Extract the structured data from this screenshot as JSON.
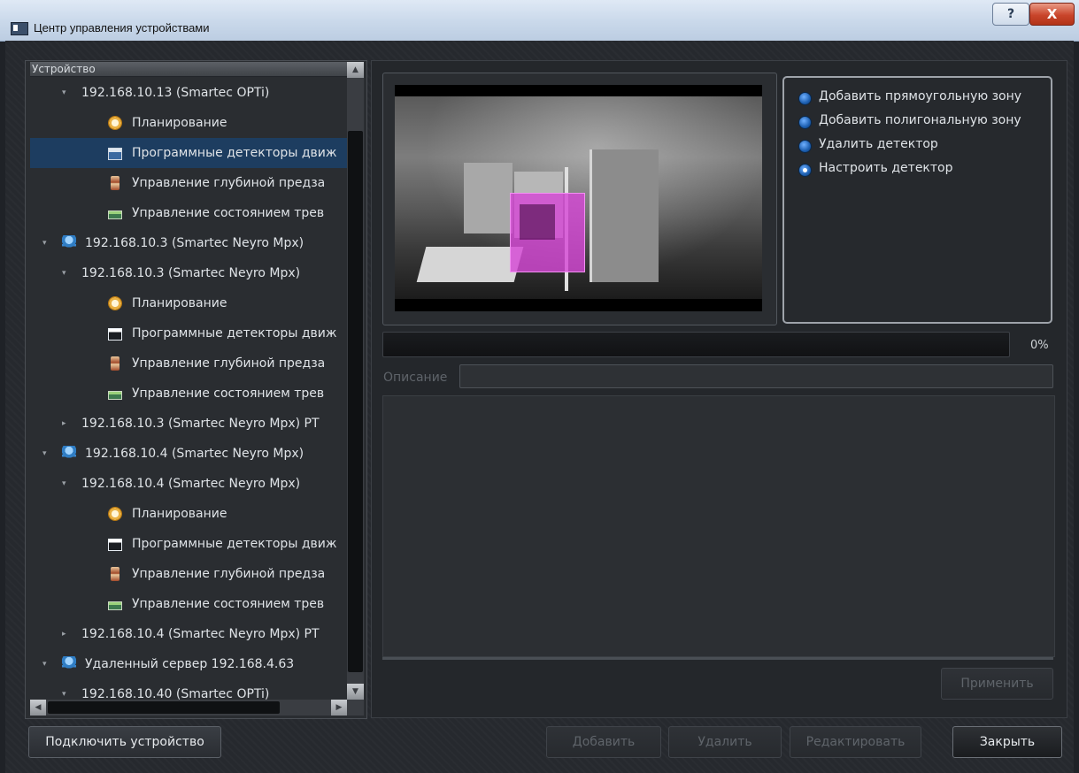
{
  "window": {
    "title": "Центр управления устройствами",
    "help_glyph": "?",
    "close_glyph": "X"
  },
  "tree": {
    "header": "Устройство",
    "rows": [
      {
        "label": "192.168.10.13 (Smartec OPTi)",
        "level": 1,
        "arrow": "▾",
        "icon": ""
      },
      {
        "label": "Планирование",
        "level": 2,
        "arrow": "",
        "icon": "clock-icon"
      },
      {
        "label": "Программные детекторы движ",
        "level": 2,
        "arrow": "",
        "icon": "motion-detector-icon",
        "selected": true
      },
      {
        "label": "Управление глубиной предза",
        "level": 2,
        "arrow": "",
        "icon": "hourglass-icon"
      },
      {
        "label": "Управление состоянием трев",
        "level": 2,
        "arrow": "",
        "icon": "alarm-state-icon"
      },
      {
        "label": "192.168.10.3 (Smartec Neyro Mpx)",
        "level": 0,
        "arrow": "▾",
        "icon": "server-icon"
      },
      {
        "label": "192.168.10.3 (Smartec Neyro Mpx)",
        "level": 1,
        "arrow": "▾",
        "icon": ""
      },
      {
        "label": "Планирование",
        "level": 2,
        "arrow": "",
        "icon": "clock-icon"
      },
      {
        "label": "Программные детекторы движ",
        "level": 2,
        "arrow": "",
        "icon": "motion-detector-icon"
      },
      {
        "label": "Управление глубиной предза",
        "level": 2,
        "arrow": "",
        "icon": "hourglass-icon"
      },
      {
        "label": "Управление состоянием трев",
        "level": 2,
        "arrow": "",
        "icon": "alarm-state-icon"
      },
      {
        "label": "192.168.10.3 (Smartec Neyro Mpx) PT",
        "level": 1,
        "arrow": "▸",
        "icon": ""
      },
      {
        "label": "192.168.10.4 (Smartec Neyro Mpx)",
        "level": 0,
        "arrow": "▾",
        "icon": "server-icon"
      },
      {
        "label": "192.168.10.4 (Smartec Neyro Mpx)",
        "level": 1,
        "arrow": "▾",
        "icon": ""
      },
      {
        "label": "Планирование",
        "level": 2,
        "arrow": "",
        "icon": "clock-icon"
      },
      {
        "label": "Программные детекторы движ",
        "level": 2,
        "arrow": "",
        "icon": "motion-detector-icon"
      },
      {
        "label": "Управление глубиной предза",
        "level": 2,
        "arrow": "",
        "icon": "hourglass-icon"
      },
      {
        "label": "Управление состоянием трев",
        "level": 2,
        "arrow": "",
        "icon": "alarm-state-icon"
      },
      {
        "label": "192.168.10.4 (Smartec Neyro Mpx) PT",
        "level": 1,
        "arrow": "▸",
        "icon": ""
      },
      {
        "label": "Удаленный сервер 192.168.4.63",
        "level": 0,
        "arrow": "▾",
        "icon": "server-icon"
      },
      {
        "label": "192.168.10.40 (Smartec OPTi)",
        "level": 1,
        "arrow": "▾",
        "icon": ""
      }
    ]
  },
  "scroll": {
    "up": "▲",
    "down": "▼",
    "left": "◀",
    "right": "▶"
  },
  "detector_options": [
    {
      "label": "Добавить прямоугольную зону",
      "checked": false
    },
    {
      "label": "Добавить полигональную зону",
      "checked": false
    },
    {
      "label": "Удалить детектор",
      "checked": false
    },
    {
      "label": "Настроить детектор",
      "checked": true
    }
  ],
  "progress": {
    "value": 0,
    "text": "0%"
  },
  "description": {
    "label": "Описание",
    "value": ""
  },
  "buttons": {
    "apply": "Применить",
    "connect": "Подключить устройство",
    "add": "Добавить",
    "delete": "Удалить",
    "edit": "Редактировать",
    "close": "Закрыть"
  },
  "colors": {
    "selection": "#1d3d60",
    "zone": "#d648d6",
    "radio": "#1d5fb0"
  }
}
